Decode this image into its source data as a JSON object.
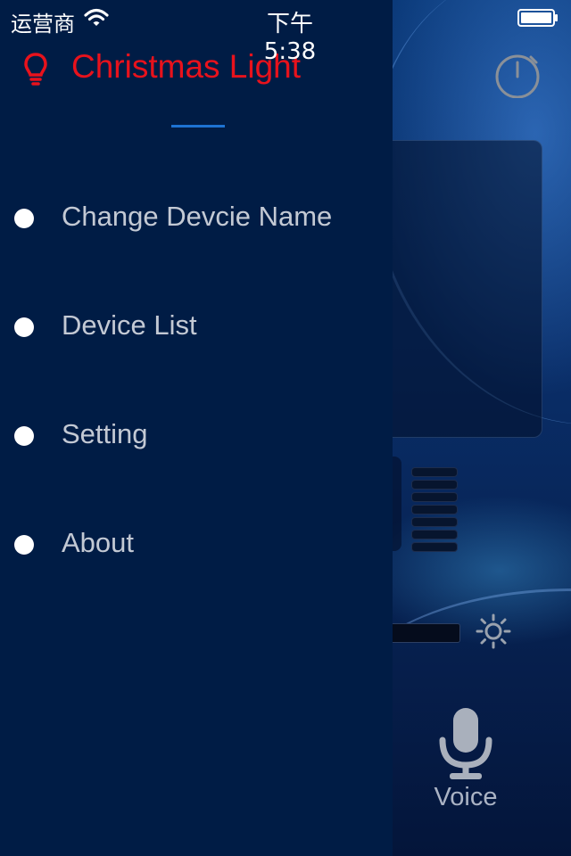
{
  "status_bar": {
    "carrier": "运营商",
    "time": "下午5:38"
  },
  "drawer": {
    "title": "Christmas Light",
    "title_color": "#e8121c",
    "icon": "lightbulb-icon",
    "menu": [
      {
        "label": "Change Devcie Name"
      },
      {
        "label": "Device List"
      },
      {
        "label": "Setting"
      },
      {
        "label": "About"
      }
    ]
  },
  "background_app": {
    "icons": [
      "timer-icon",
      "brightness-icon",
      "microphone-icon"
    ],
    "voice_label": "Voice"
  }
}
